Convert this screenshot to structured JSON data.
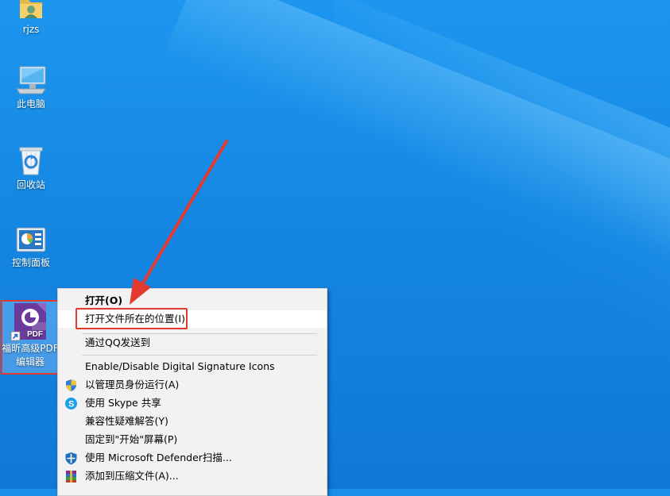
{
  "desktop": {
    "icons": [
      {
        "label": "rjzs",
        "icon": "user-folder-icon"
      },
      {
        "label": "此电脑",
        "icon": "computer-icon"
      },
      {
        "label": "回收站",
        "icon": "recycle-bin-icon"
      },
      {
        "label": "控制面板",
        "icon": "control-panel-icon"
      },
      {
        "label": "福昕高级PDF编辑器",
        "line1": "福昕高级PDF",
        "line2": "编辑器",
        "icon": "foxit-pdf-icon",
        "badge": "PDF"
      }
    ]
  },
  "context_menu": {
    "items": [
      {
        "label": "打开(O)",
        "bold": true
      },
      {
        "label": "打开文件所在的位置(I)",
        "highlighted": true
      },
      {
        "label": "通过QQ发送到"
      },
      {
        "label": "Enable/Disable Digital Signature Icons"
      },
      {
        "label": "以管理员身份运行(A)",
        "icon": "uac-shield-icon"
      },
      {
        "label": "使用 Skype 共享",
        "icon": "skype-icon"
      },
      {
        "label": "兼容性疑难解答(Y)"
      },
      {
        "label": "固定到\"开始\"屏幕(P)"
      },
      {
        "label": "使用 Microsoft Defender扫描...",
        "icon": "defender-icon"
      },
      {
        "label": "添加到压缩文件(A)...",
        "icon": "winrar-icon"
      }
    ]
  },
  "colors": {
    "desktop_bg": "#1487e2",
    "annotation_red": "#e23a2f",
    "menu_bg": "#f2f2f2"
  }
}
